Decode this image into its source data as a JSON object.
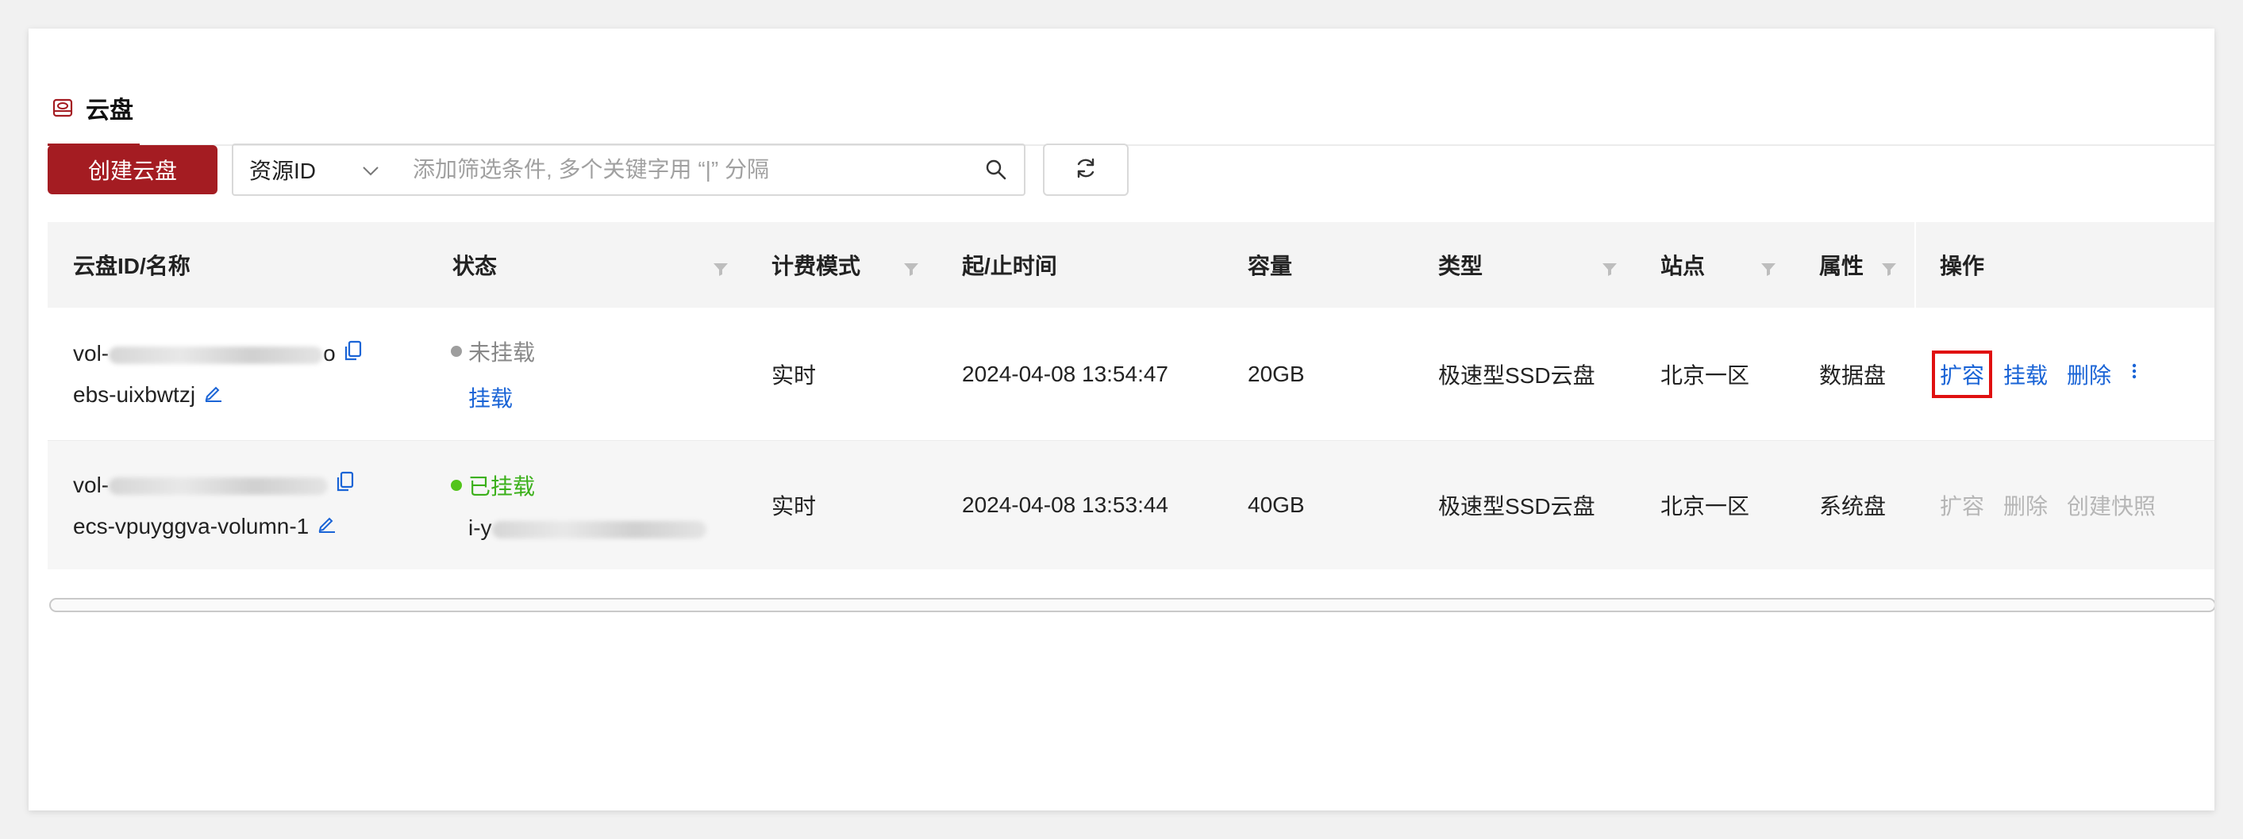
{
  "tab": {
    "label": "云盘",
    "icon": "cloud-disk-icon"
  },
  "toolbar": {
    "create_label": "创建云盘",
    "filter_select": "资源ID",
    "search_placeholder": "添加筛选条件, 多个关键字用 “|” 分隔"
  },
  "columns": [
    "云盘ID/名称",
    "状态",
    "计费模式",
    "起/止时间",
    "容量",
    "类型",
    "站点",
    "属性",
    "操作"
  ],
  "rows": [
    {
      "id_prefix": "vol-",
      "id_suffix": "o",
      "name": "ebs-uixbwtzj",
      "status": "未挂载",
      "status_color": "#9e9e9e",
      "status_action": "挂载",
      "billing": "实时",
      "time": "2024-04-08 13:54:47",
      "capacity": "20GB",
      "type": "极速型SSD云盘",
      "site": "北京一区",
      "attribute": "数据盘",
      "actions": [
        "扩容",
        "挂载",
        "删除"
      ]
    },
    {
      "id_prefix": "vol-",
      "id_suffix": "",
      "name": "ecs-vpuyggva-volumn-1",
      "status": "已挂载",
      "status_color": "#52c41a",
      "instance_prefix": "i-y",
      "billing": "实时",
      "time": "2024-04-08 13:53:44",
      "capacity": "40GB",
      "type": "极速型SSD云盘",
      "site": "北京一区",
      "attribute": "系统盘",
      "actions": [
        "扩容",
        "删除",
        "创建快照"
      ]
    }
  ],
  "colors": {
    "brand": "#a41c22",
    "link": "#1a64d6",
    "highlight": "#e01010"
  }
}
